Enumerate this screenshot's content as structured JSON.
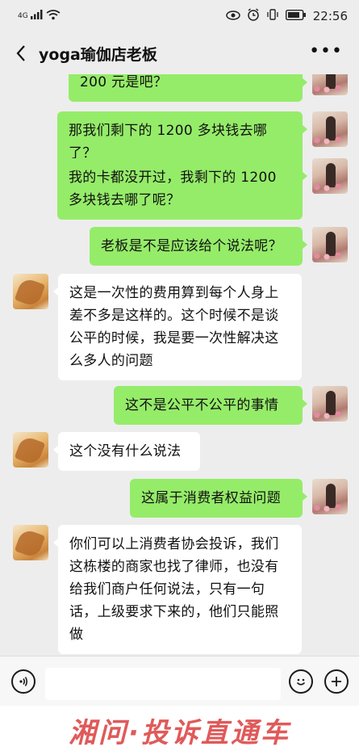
{
  "status": {
    "signal": "4G",
    "time": "22:56"
  },
  "nav": {
    "title": "yoga瑜伽店老板",
    "more": "•••"
  },
  "messages": [
    {
      "from": "me",
      "text": "200 元是吧？"
    },
    {
      "from": "me",
      "text": "那我们剩下的 1200 多块钱去哪了？"
    },
    {
      "from": "me",
      "line1": "我的卡都没开过，我剩下的 1200",
      "line2": "多块钱去哪了呢？"
    },
    {
      "from": "me",
      "text": "老板是不是应该给个说法呢？"
    },
    {
      "from": "them",
      "line1": "这是一次性的费用算到每个人身上",
      "line2": "差不多是这样的。这个时候不是谈",
      "line3": "公平的时候，我是要一次性解决这",
      "line4": "么多人的问题"
    },
    {
      "from": "me",
      "text": "这不是公平不公平的事情"
    },
    {
      "from": "them",
      "text": "这个没有什么说法"
    },
    {
      "from": "me",
      "text": "这属于消费者权益问题"
    },
    {
      "from": "them",
      "line1": "你们可以上消费者协会投诉，我们",
      "line2": "这栋楼的商家也找了律师，也没有",
      "line3": "给我们商户任何说法，只有一句",
      "line4": "话，上级要求下来的，他们只能照",
      "line5": "做"
    }
  ],
  "footer": {
    "watermark": "湘问·投诉直通车"
  }
}
